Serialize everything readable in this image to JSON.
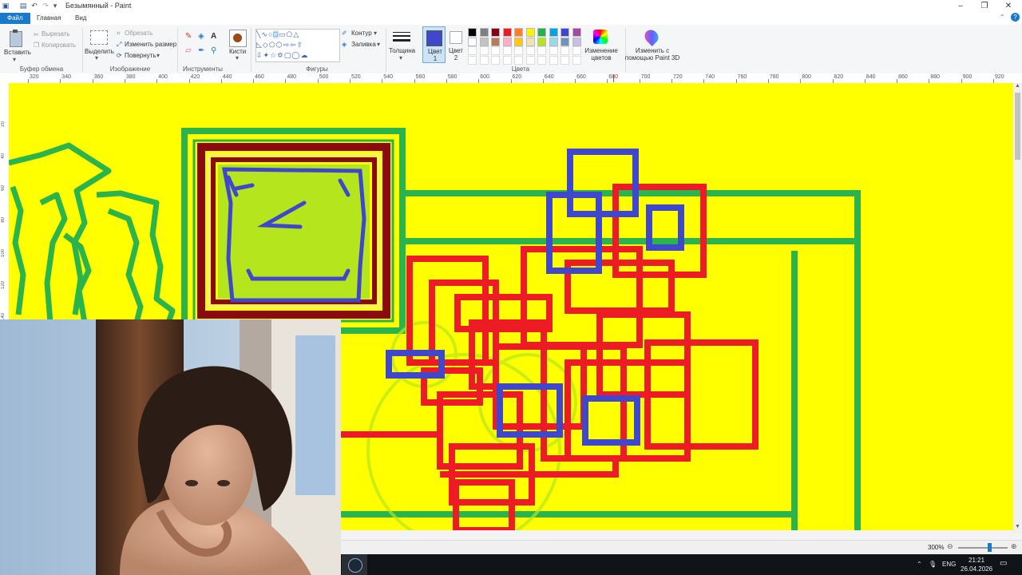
{
  "app": {
    "window_title": "Безымянный - Paint"
  },
  "tabs": [
    {
      "label": "Файл"
    },
    {
      "label": "Главная"
    },
    {
      "label": "Вид"
    }
  ],
  "ribbon": {
    "clipboard": {
      "paste_label": "Вставить",
      "cut_label": "Вырезать",
      "copy_label": "Копировать",
      "group_label": "Буфер обмена"
    },
    "image": {
      "select_label": "Выделить",
      "crop_label": "Обрезать",
      "resize_label": "Изменить размер",
      "rotate_label": "Повернуть",
      "group_label": "Изображение"
    },
    "tools": {
      "brushes_label": "Кисти",
      "group_label": "Инструменты"
    },
    "shapes": {
      "outline_label": "Контур",
      "fill_label": "Заливка",
      "group_label": "Фигуры"
    },
    "size_label": "Толщина",
    "color1_label": "Цвет 1",
    "color2_label": "Цвет 2",
    "colors_group_label": "Цвета",
    "edit_colors_label": "Изменение цветов",
    "paint3d_label": "Изменить с помощью Paint 3D",
    "palette_row1": [
      "#000000",
      "#7f7f7f",
      "#880015",
      "#ed1c24",
      "#ff7f27",
      "#fff200",
      "#22b14c",
      "#00a2e8",
      "#3f48cc",
      "#a349a4"
    ],
    "palette_row2": [
      "#ffffff",
      "#c3c3c3",
      "#b97a57",
      "#ffaec9",
      "#ffc90e",
      "#efe4b0",
      "#b5e61d",
      "#99d9ea",
      "#7092be",
      "#c8bfe7"
    ],
    "color1": "#3f48cc",
    "color2": "#ffffff"
  },
  "ruler": {
    "ticks": [
      "320",
      "340",
      "360",
      "380",
      "400",
      "420",
      "440",
      "460",
      "480",
      "500",
      "520",
      "540",
      "560",
      "580",
      "600",
      "620",
      "640",
      "660",
      "680",
      "700",
      "720",
      "740",
      "760",
      "780",
      "800",
      "820",
      "840",
      "860",
      "880",
      "900",
      "920"
    ],
    "vticks": [
      "20",
      "40",
      "60",
      "80",
      "100",
      "120",
      "140"
    ]
  },
  "status": {
    "zoom": "300%"
  },
  "taskbar": {
    "language": "ENG",
    "time": "21:21",
    "date": "26.04.2026"
  }
}
